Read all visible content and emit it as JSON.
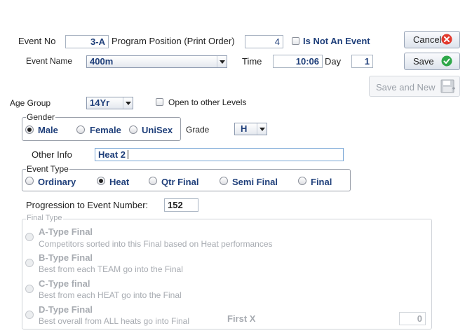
{
  "event_no": {
    "label": "Event No",
    "value": "3-A"
  },
  "program_position": {
    "label": "Program Position (Print Order)",
    "value": "4"
  },
  "is_not_event": {
    "label": "Is Not An Event"
  },
  "buttons": {
    "cancel": "Cancel",
    "save": "Save",
    "save_and_new": "Save and New"
  },
  "event_name": {
    "label": "Event Name",
    "value": "400m"
  },
  "time": {
    "label": "Time",
    "value": "10:06"
  },
  "day": {
    "label": "Day",
    "value": "1"
  },
  "age_group": {
    "label": "Age Group",
    "value": "14Yr"
  },
  "open_other_levels": {
    "label": "Open to other Levels"
  },
  "gender": {
    "title": "Gender",
    "options": [
      "Male",
      "Female",
      "UniSex"
    ],
    "selected": "Male"
  },
  "grade": {
    "label": "Grade",
    "value": "H"
  },
  "other_info": {
    "label": "Other Info",
    "value": "Heat 2"
  },
  "event_type": {
    "title": "Event Type",
    "options": [
      "Ordinary",
      "Heat",
      "Qtr Final",
      "Semi Final",
      "Final"
    ],
    "selected": "Heat"
  },
  "progression": {
    "label": "Progression to Event Number:",
    "value": "152"
  },
  "final_type": {
    "title": "Final Type",
    "options": [
      {
        "name": "A-Type Final",
        "desc": "Competitors sorted into this Final based on Heat performances"
      },
      {
        "name": "B-Type Final",
        "desc": "Best from each TEAM go into the Final"
      },
      {
        "name": "C-Type final",
        "desc": "Best from each HEAT go into the Final"
      },
      {
        "name": "D-Type Final",
        "desc": "Best overall from ALL heats go into Final"
      }
    ],
    "first_x_label": "First X",
    "first_x_value": "0"
  }
}
